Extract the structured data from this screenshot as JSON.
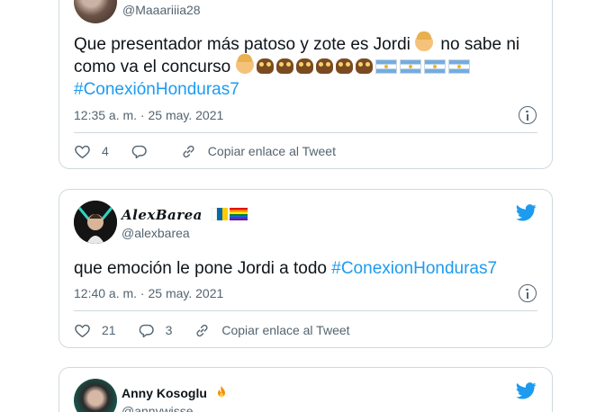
{
  "tweets": [
    {
      "handle": "@Maaariiia28",
      "text_parts": [
        "Que presentador más patoso y zote es Jordi ",
        " no sabe ni como va el concurso "
      ],
      "emoji": [
        "person-facepalming",
        "person-shrugging",
        "owl",
        "owl",
        "owl",
        "owl",
        "owl",
        "owl",
        "flag-argentina",
        "flag-argentina",
        "flag-argentina",
        "flag-argentina"
      ],
      "hashtag": "#ConexiónHonduras7",
      "timestamp": "12:35 a. m. · 25 may. 2021",
      "likes": "4",
      "copy_link": "Copiar enlace al Tweet"
    },
    {
      "name": "AlexBarea",
      "name_emoji": [
        "flag-canary-islands",
        "rainbow-flag"
      ],
      "handle": "@alexbarea",
      "text": "que emoción le pone Jordi a todo ",
      "hashtag": "#ConexionHonduras7",
      "timestamp": "12:40 a. m. · 25 may. 2021",
      "likes": "21",
      "replies": "3",
      "copy_link": "Copiar enlace al Tweet"
    },
    {
      "name": "Anny Kosoglu",
      "name_emoji": [
        "fire"
      ],
      "handle": "@annywisse"
    }
  ],
  "colors": {
    "link": "#1d9bf0",
    "muted": "#536471",
    "border": "#cfd9de",
    "text": "#0f1419"
  }
}
